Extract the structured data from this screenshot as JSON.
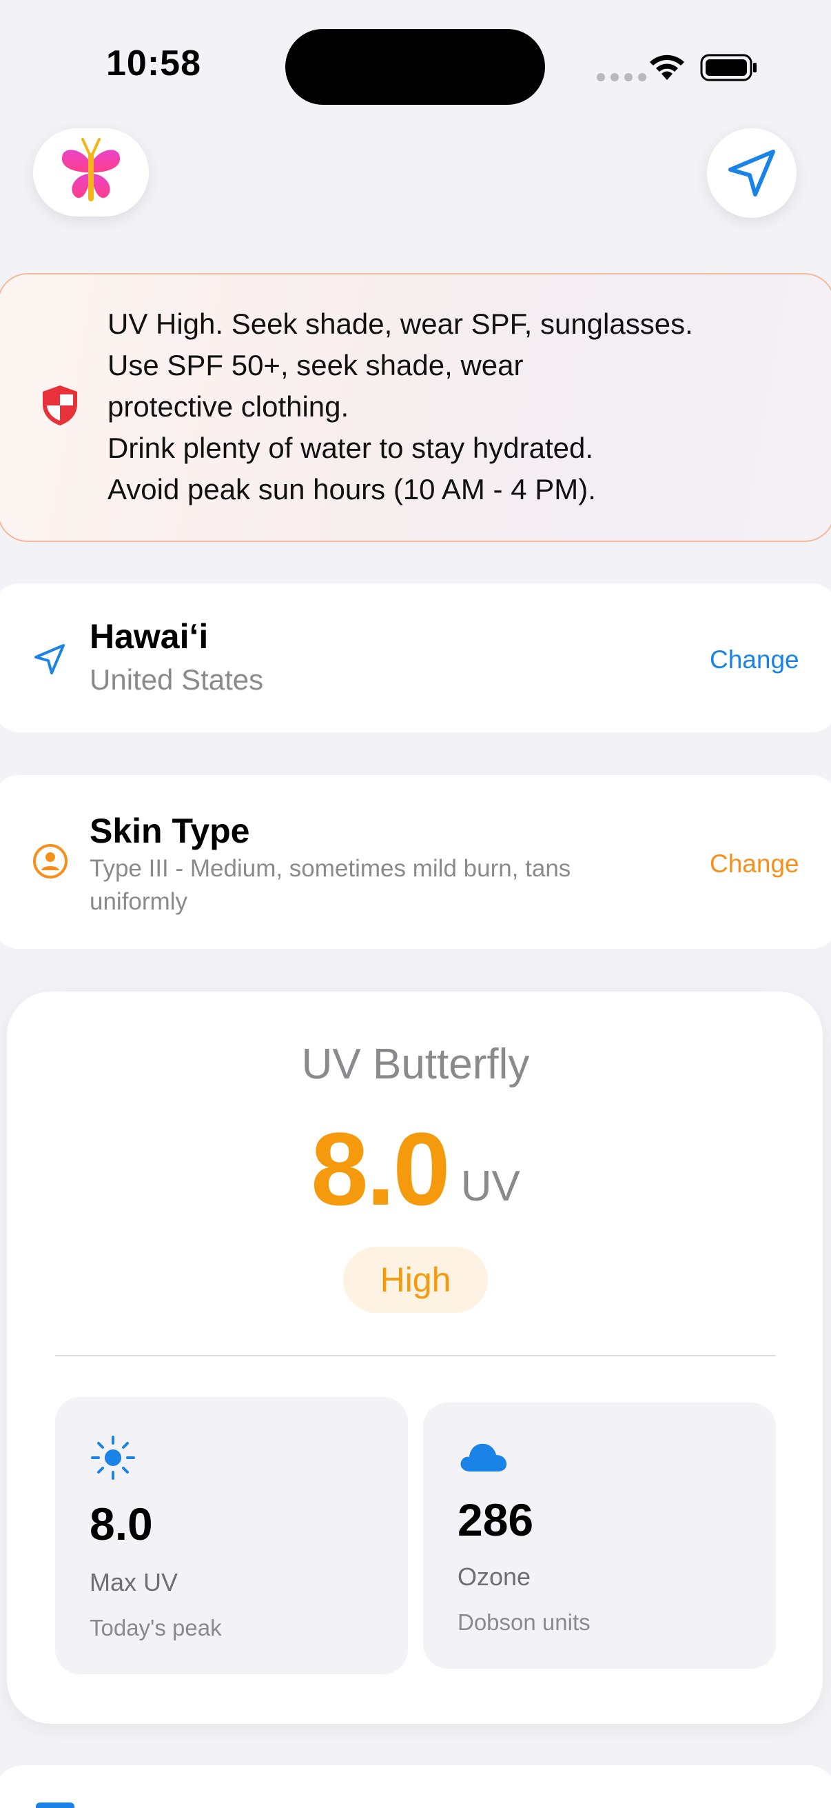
{
  "status_bar": {
    "time": "10:58"
  },
  "header": {
    "logo_icon": "butterfly-logo",
    "location_button_icon": "location-arrow-icon"
  },
  "advice": {
    "icon": "shield-icon",
    "lines": [
      "UV High. Seek shade, wear SPF, sunglasses.",
      "Use SPF 50+, seek shade, wear",
      "protective clothing.",
      "Drink plenty of water to stay hydrated.",
      "Avoid peak sun hours (10 AM - 4 PM)."
    ]
  },
  "location": {
    "name": "Hawaiʻi",
    "country": "United States",
    "change_label": "Change"
  },
  "skin": {
    "title": "Skin Type",
    "description": "Type III - Medium, sometimes mild burn, tans uniformly",
    "change_label": "Change"
  },
  "uv": {
    "title": "UV Butterfly",
    "value": "8.0",
    "unit": "UV",
    "level": "High"
  },
  "stats": {
    "max_uv": {
      "value": "8.0",
      "label": "Max UV",
      "note": "Today's peak"
    },
    "ozone": {
      "value": "286",
      "label": "Ozone",
      "note": "Dobson units"
    }
  },
  "colors": {
    "accent_blue": "#1a83e8",
    "accent_orange": "#f5901d",
    "uv_orange": "#f59a0c",
    "shield_red": "#e8323a"
  }
}
